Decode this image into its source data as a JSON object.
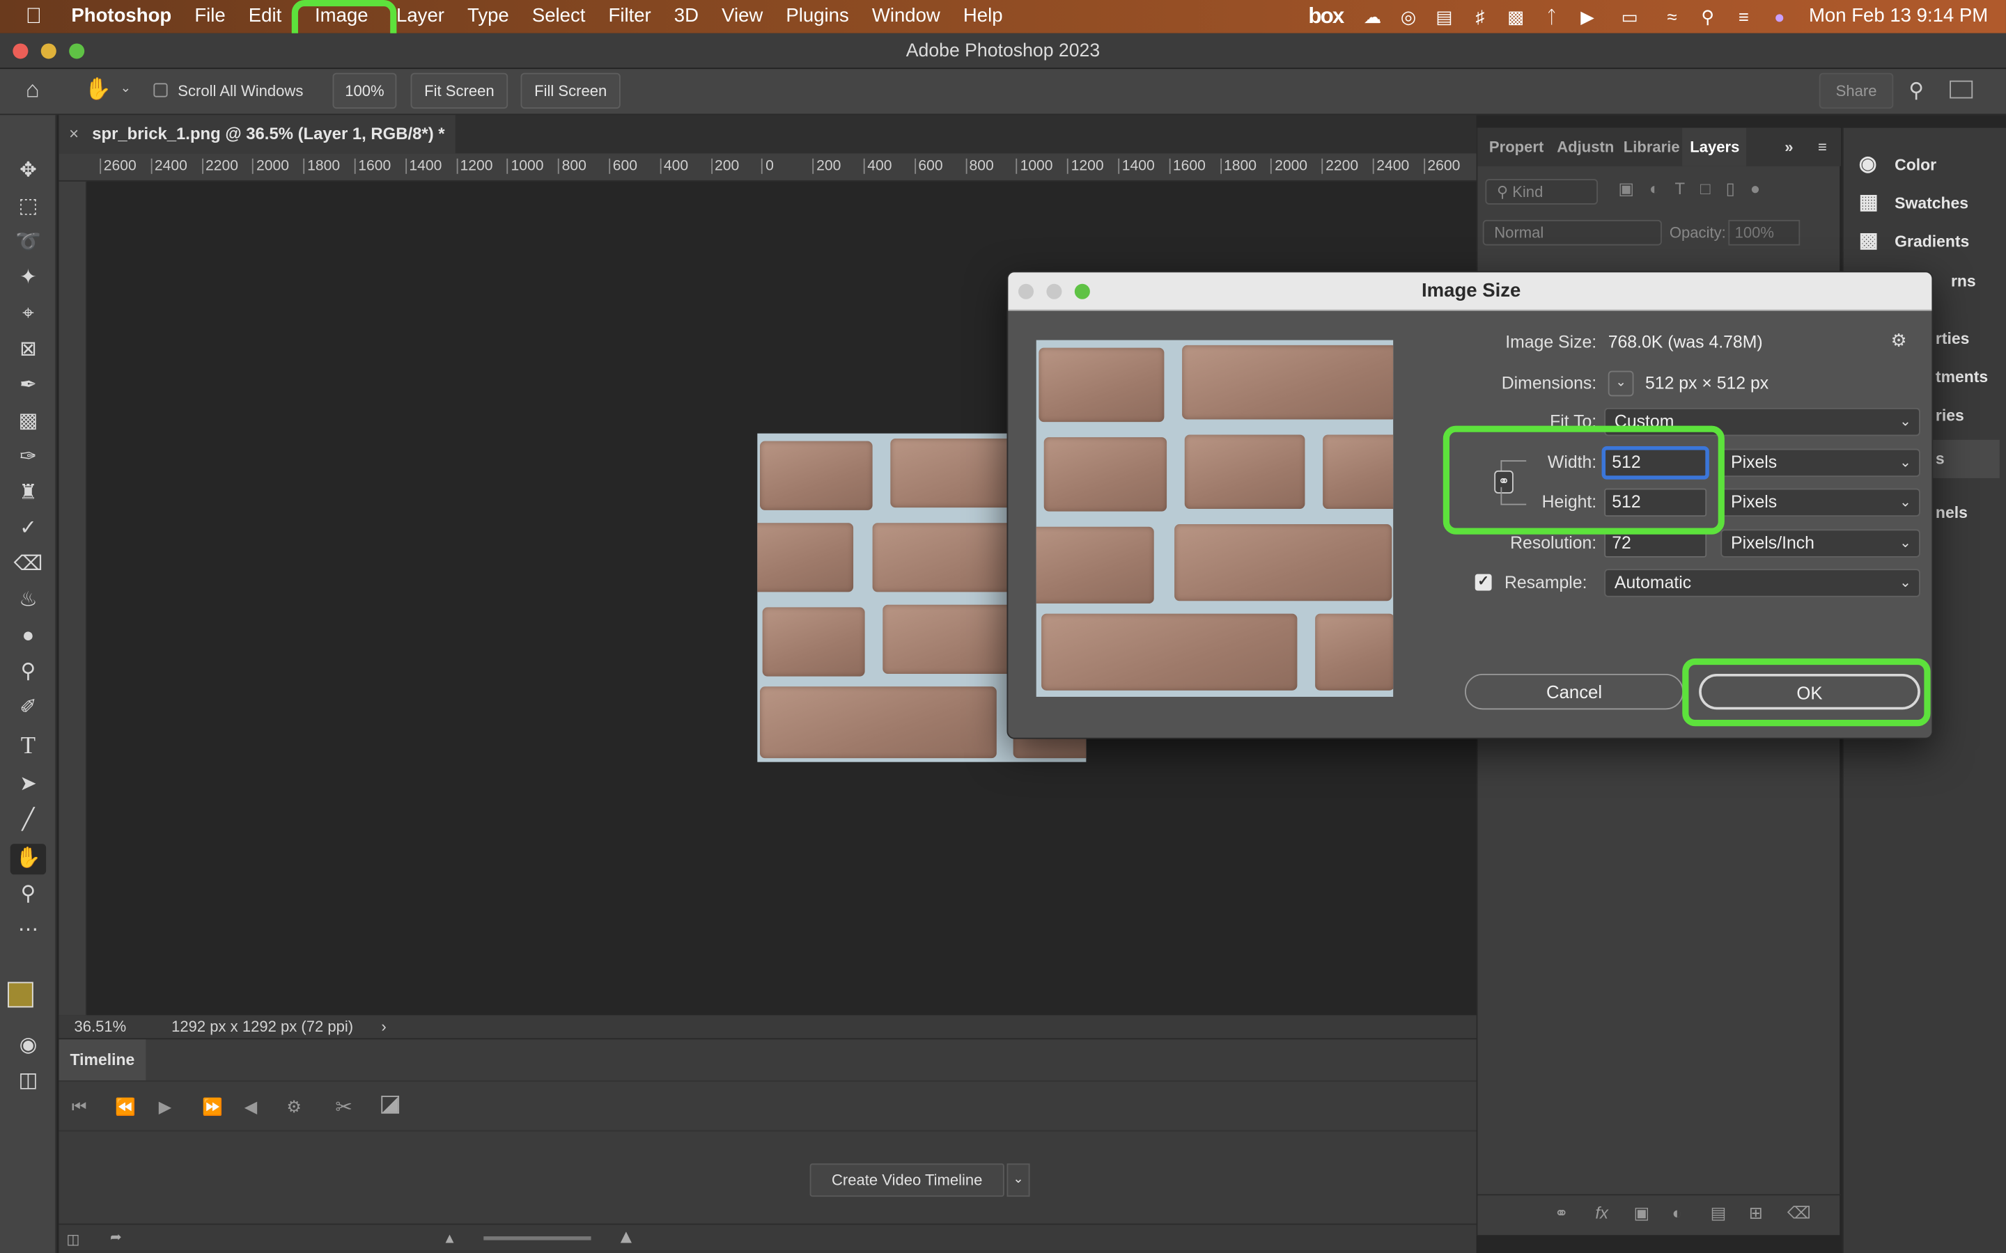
{
  "menubar": {
    "app": "Photoshop",
    "items": [
      "File",
      "Edit",
      "Image",
      "Layer",
      "Type",
      "Select",
      "Filter",
      "3D",
      "View",
      "Plugins",
      "Window",
      "Help"
    ],
    "clock": "Mon Feb 13  9:14 PM",
    "box_label": "box"
  },
  "window": {
    "title": "Adobe Photoshop 2023"
  },
  "options": {
    "scroll_all_label": "Scroll All Windows",
    "zoom_btn": "100%",
    "fit_screen": "Fit Screen",
    "fill_screen": "Fill Screen",
    "share": "Share"
  },
  "document": {
    "tab_title": "spr_brick_1.png @ 36.5% (Layer 1, RGB/8*) *",
    "ruler_h": [
      "2600",
      "2400",
      "2200",
      "2000",
      "1800",
      "1600",
      "1400",
      "1200",
      "1000",
      "800",
      "600",
      "400",
      "200",
      "0",
      "200",
      "400",
      "600",
      "800",
      "1000",
      "1200",
      "1400",
      "1600",
      "1800",
      "2000",
      "2200",
      "2400",
      "2600"
    ],
    "zoom": "36.51%",
    "info": "1292 px x 1292 px (72 ppi)"
  },
  "timeline": {
    "tab": "Timeline",
    "create_btn": "Create Video Timeline"
  },
  "layers_panel": {
    "tabs": [
      "Propert",
      "Adjustn",
      "Librarie",
      "Layers"
    ],
    "kind": "Kind",
    "blend": "Normal",
    "opacity_label": "Opacity:",
    "opacity_value": "100%"
  },
  "right_panels": {
    "items": [
      "Color",
      "Swatches",
      "Gradients"
    ],
    "partial": [
      "rns",
      "rties",
      "tments",
      "ries",
      "s",
      "nels"
    ]
  },
  "dialog": {
    "title": "Image Size",
    "image_size_label": "Image Size:",
    "image_size_value": "768.0K (was 4.78M)",
    "dimensions_label": "Dimensions:",
    "dimensions_value": "512 px  ×  512 px",
    "fit_to_label": "Fit To:",
    "fit_to_value": "Custom",
    "width_label": "Width:",
    "width_value": "512",
    "width_unit": "Pixels",
    "height_label": "Height:",
    "height_value": "512",
    "height_unit": "Pixels",
    "resolution_label": "Resolution:",
    "resolution_value": "72",
    "resolution_unit": "Pixels/Inch",
    "resample_label": "Resample:",
    "resample_value": "Automatic",
    "resample_checked": true,
    "cancel": "Cancel",
    "ok": "OK"
  },
  "colors": {
    "highlight": "#5de23c",
    "foreground": "#a08a30",
    "background": "#ffffff"
  }
}
